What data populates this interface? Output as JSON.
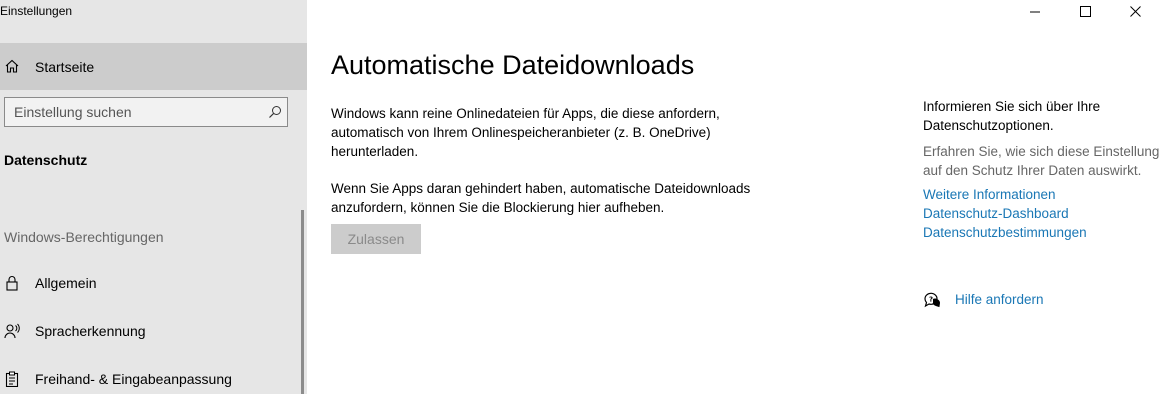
{
  "window": {
    "title": "Einstellungen",
    "controls": {
      "minimize_icon": "minimize-icon",
      "maximize_icon": "maximize-icon",
      "close_icon": "close-icon"
    }
  },
  "sidebar": {
    "home": {
      "label": "Startseite",
      "icon": "home-icon"
    },
    "search": {
      "placeholder": "Einstellung suchen",
      "value": "",
      "icon": "search-icon"
    },
    "section_title": "Datenschutz",
    "group_header": "Windows-Berechtigungen",
    "items": [
      {
        "label": "Allgemein",
        "icon": "lock-icon"
      },
      {
        "label": "Spracherkennung",
        "icon": "speech-icon"
      },
      {
        "label": "Freihand- & Eingabeanpassung",
        "icon": "clipboard-icon"
      }
    ]
  },
  "main": {
    "title": "Automatische Dateidownloads",
    "paragraph1": "Windows kann reine Onlinedateien für Apps, die diese anfordern,\nautomatisch von Ihrem Onlinespeicheranbieter (z. B. OneDrive)\nherunterladen.",
    "paragraph2": "Wenn Sie Apps daran gehindert haben, automatische Dateidownloads\nanzufordern, können Sie die Blockierung hier aufheben.",
    "allow_button": "Zulassen"
  },
  "aside": {
    "heading": "Informieren Sie sich über Ihre\nDatenschutzoptionen.",
    "description": "Erfahren Sie, wie sich diese Einstellung\nauf den Schutz Ihrer Daten auswirkt.",
    "links": [
      "Weitere Informationen",
      "Datenschutz-Dashboard",
      "Datenschutzbestimmungen"
    ],
    "help": {
      "label": "Hilfe anfordern",
      "icon": "help-chat-icon"
    }
  },
  "colors": {
    "sidebar_bg": "#e6e6e6",
    "selected_bg": "#cccccc",
    "link": "#1a77b5",
    "disabled_button_bg": "#cccccc",
    "disabled_button_text": "#8a8a8a"
  }
}
